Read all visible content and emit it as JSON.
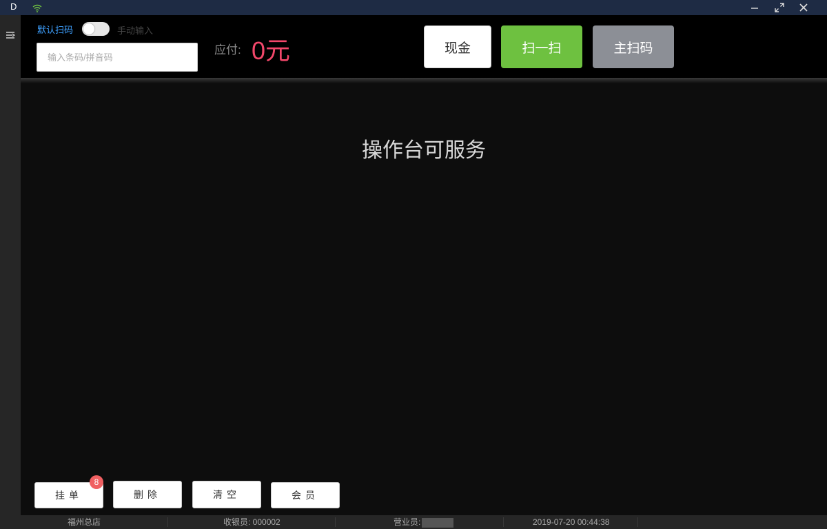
{
  "titlebar": {
    "app_letter": "D",
    "icons": [
      "wifi-icon",
      "minimize-icon",
      "maximize-icon",
      "close-icon"
    ]
  },
  "sidebar": {
    "icon": "menu-icon"
  },
  "header": {
    "scan_mode_label": "默认扫码",
    "manual_mode_label": "手动输入",
    "toggle_on": false,
    "barcode_placeholder": "输入条码/拼音码",
    "barcode_value": "",
    "amount_due_label": "应付:",
    "amount_due_value": "0元",
    "pay_buttons": {
      "cash": "现金",
      "scan": "扫一扫",
      "main_scan": "主扫码"
    }
  },
  "main": {
    "status_text": "操作台可服务"
  },
  "actions": {
    "hang_order": "挂单",
    "hang_order_count": "8",
    "delete": "删除",
    "clear": "清空",
    "member": "会员"
  },
  "statusbar": {
    "store": "福州总店",
    "cashier": "收银员: 000002",
    "salesperson_label": "营业员:",
    "datetime": "2019-07-20 00:44:38"
  },
  "colors": {
    "accent_blue": "#3ea0ff",
    "amount_red": "#f2476a",
    "scan_green": "#6ec140",
    "main_scan_gray": "#8c8f96",
    "badge_red": "#f06062"
  }
}
